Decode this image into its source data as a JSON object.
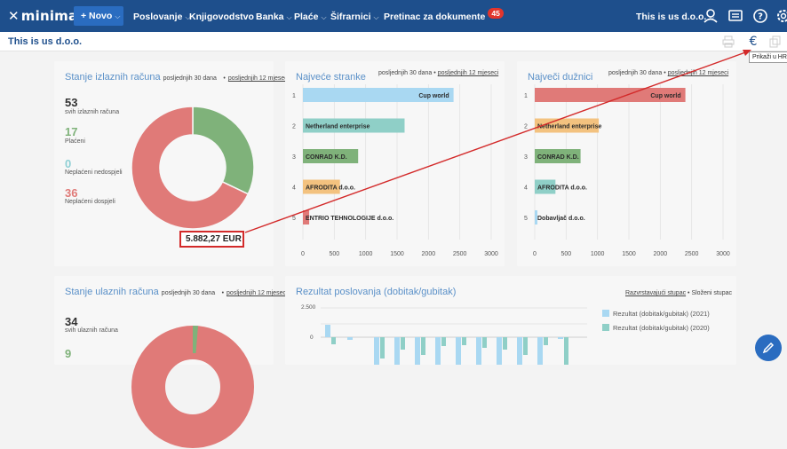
{
  "topbar": {
    "logo": "minimax",
    "novo": "+ Novo",
    "menu": [
      "Poslovanje",
      "Knjigovodstvo",
      "Banka",
      "Plaće",
      "Šifrarnici"
    ],
    "inbox_label": "Pretinac za dokumente",
    "inbox_count": "45",
    "company_select": "This is us d.o.o."
  },
  "subbar": {
    "company": "This is us d.o.o.",
    "tooltip": "Prikaži u HRK"
  },
  "invoices_out": {
    "title": "Stanje izlaznih računa",
    "period_30": "posljednjih 30 dana",
    "period_sep": "•",
    "period_12": "posljednjih 12 mjeseci",
    "stats": [
      {
        "value": "53",
        "label": "svih izlaznih računa",
        "color": "#333333"
      },
      {
        "value": "17",
        "label": "Plaćeni",
        "color": "#7fb27a"
      },
      {
        "value": "0",
        "label": "Neplaćeni nedospjeli",
        "color": "#8ecfd4"
      },
      {
        "value": "36",
        "label": "Neplaćeni dospjeli",
        "color": "#e07a78"
      }
    ],
    "amount": "5.882,27 EUR"
  },
  "chart_data": [
    {
      "type": "bar",
      "title": "Najveće stranke",
      "orientation": "horizontal",
      "categories": [
        "Cup world",
        "Netherland enterprise",
        "CONRAD K.D.",
        "AFRODITA d.o.o.",
        "ENTRIO TEHNOLOGIJE d.o.o."
      ],
      "rank_labels": [
        "1",
        "2",
        "3",
        "4",
        "5"
      ],
      "values": [
        2400,
        1620,
        880,
        590,
        100
      ],
      "colors": [
        "#a9d8f2",
        "#8fcfc7",
        "#7fb27a",
        "#f3c27f",
        "#e07a78"
      ],
      "xticks": [
        "0",
        "500",
        "1000",
        "1500",
        "2000",
        "2500",
        "3000"
      ],
      "xlim": [
        0,
        3000
      ]
    },
    {
      "type": "bar",
      "title": "Največi dužnici",
      "orientation": "horizontal",
      "categories": [
        "Cup world",
        "Netherland enterprise",
        "CONRAD K.D.",
        "AFRODITA d.o.o.",
        "Dobavljač d.o.o."
      ],
      "rank_labels": [
        "1",
        "2",
        "3",
        "4",
        "5"
      ],
      "values": [
        2400,
        1020,
        730,
        330,
        40
      ],
      "colors": [
        "#e07a78",
        "#f3c27f",
        "#7fb27a",
        "#8fcfc7",
        "#a9d8f2"
      ],
      "xticks": [
        "0",
        "500",
        "1000",
        "1500",
        "2000",
        "2500",
        "3000"
      ],
      "xlim": [
        0,
        3000
      ]
    },
    {
      "type": "pie",
      "title": "Stanje izlaznih računa",
      "labels": [
        "Plaćeni",
        "Neplaćeni nedospjeli",
        "Neplaćeni dospjeli"
      ],
      "values": [
        17,
        0,
        36
      ],
      "colors": [
        "#7fb27a",
        "#8ecfd4",
        "#e07a78"
      ]
    }
  ],
  "invoices_in": {
    "title": "Stanje ulaznih računa",
    "period_30": "posljednjih 30 dana",
    "period_sep": "•",
    "period_12": "posljednjih 12 mjeseci",
    "total": "34",
    "total_label": "svih ulaznih računa",
    "paid": "9"
  },
  "results": {
    "title": "Rezultat poslovanja (dobitak/gubitak)",
    "mode_active": "Razvrstavajući stupac",
    "mode_sep": "•",
    "mode_other": "Složeni stupac",
    "y_top": "2.500",
    "y_zero": "0",
    "legend": [
      {
        "label": "Rezultat (dobitak/gubitak) (2021)",
        "color": "#a9d8f2"
      },
      {
        "label": "Rezultat (dobitak/gubitak) (2020)",
        "color": "#8fcfc7"
      }
    ]
  }
}
